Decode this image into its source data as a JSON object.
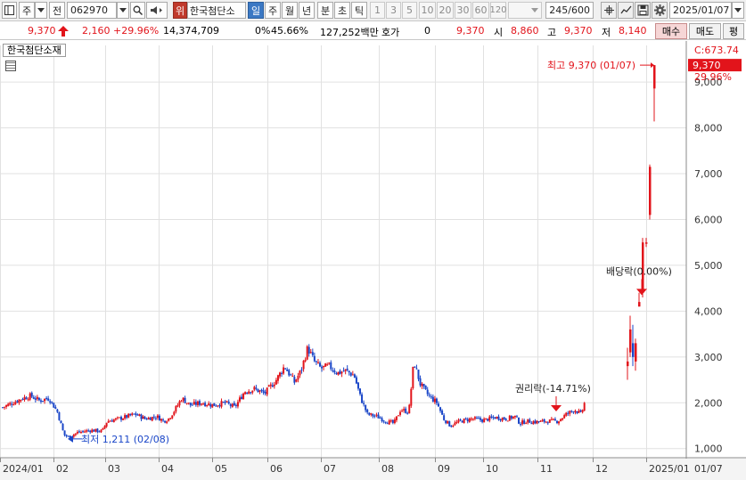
{
  "toolbar": {
    "mode_label": "주",
    "prev_label": "전",
    "code": "062970",
    "warning_badge": "위",
    "stock_name": "한국첨단소",
    "periods": [
      "일",
      "주",
      "월",
      "년",
      "분",
      "초",
      "틱"
    ],
    "active_period": "일",
    "intervals": [
      "1",
      "3",
      "5",
      "10",
      "20",
      "30",
      "60",
      "120"
    ],
    "count_display": "245/600",
    "date": "2025/01/07",
    "icons": [
      "layout-icon",
      "chevron-down-icon",
      "search-icon",
      "speaker-icon",
      "crosshair-icon",
      "chart-tool-icon",
      "save-icon",
      "gear-icon"
    ]
  },
  "quote": {
    "price": "9,370",
    "change": "2,160",
    "change_pct": "+29.96%",
    "volume": "14,374,709",
    "ratio_zero": "0%",
    "ratio": "45.66%",
    "amount": "127,252백만",
    "hoga_label": "호가",
    "hoga_value": "0",
    "hoga_price": "9,370",
    "open_label": "시",
    "open": "8,860",
    "high_label": "고",
    "high": "9,370",
    "low_label": "저",
    "low": "8,140",
    "buy_label": "매수",
    "sell_label": "매도",
    "avg_label": "평"
  },
  "chart": {
    "name_tag": "한국첨단소재",
    "price_flag": "9,370",
    "change_flag": "29.96%",
    "top_axis_label": "C:673.74",
    "annotations": {
      "high": "최고 9,370 (01/07)",
      "low": "최저 1,211 (02/08)",
      "dividend": "배당락(0.00%)",
      "rights": "권리락(-14.71%)"
    },
    "x_tick_labels": [
      "2024/01",
      "02",
      "03",
      "04",
      "05",
      "06",
      "07",
      "08",
      "09",
      "10",
      "11",
      "12",
      "2025/01",
      "01/07"
    ],
    "y_tick_labels": [
      "1,000",
      "2,000",
      "3,000",
      "4,000",
      "5,000",
      "6,000",
      "7,000",
      "8,000",
      "9,000"
    ],
    "up_color": "#e2141b",
    "down_color": "#1a46c8"
  },
  "chart_data": {
    "type": "candlestick",
    "title": "한국첨단소재",
    "ylim": [
      800,
      9800
    ],
    "y_ticks": [
      1000,
      2000,
      3000,
      4000,
      5000,
      6000,
      7000,
      8000,
      9000
    ],
    "months": [
      "2024/01",
      "02",
      "03",
      "04",
      "05",
      "06",
      "07",
      "08",
      "09",
      "10",
      "11",
      "12",
      "2025/01"
    ],
    "monthly_close": [
      1950,
      1300,
      1560,
      1730,
      1950,
      2250,
      2850,
      2050,
      2150,
      1620,
      1650,
      1800,
      9370
    ],
    "points": [
      {
        "d": 0,
        "c": 1900
      },
      {
        "d": 12,
        "c": 2000
      },
      {
        "d": 24,
        "c": 2100
      },
      {
        "d": 34,
        "c": 2150
      },
      {
        "d": 44,
        "c": 2050
      },
      {
        "d": 56,
        "c": 2100
      },
      {
        "d": 66,
        "c": 1800
      },
      {
        "d": 74,
        "c": 1300
      },
      {
        "d": 80,
        "c": 1250
      },
      {
        "d": 90,
        "c": 1350
      },
      {
        "d": 106,
        "c": 1400
      },
      {
        "d": 120,
        "c": 1380
      },
      {
        "d": 126,
        "c": 1600
      },
      {
        "d": 140,
        "c": 1650
      },
      {
        "d": 150,
        "c": 1700
      },
      {
        "d": 160,
        "c": 1750
      },
      {
        "d": 172,
        "c": 1650
      },
      {
        "d": 186,
        "c": 1700
      },
      {
        "d": 194,
        "c": 1600
      },
      {
        "d": 200,
        "c": 1650
      },
      {
        "d": 208,
        "c": 1850
      },
      {
        "d": 216,
        "c": 2100
      },
      {
        "d": 226,
        "c": 1950
      },
      {
        "d": 240,
        "c": 2000
      },
      {
        "d": 254,
        "c": 1950
      },
      {
        "d": 268,
        "c": 2000
      },
      {
        "d": 280,
        "c": 1900
      },
      {
        "d": 292,
        "c": 2250
      },
      {
        "d": 304,
        "c": 2300
      },
      {
        "d": 316,
        "c": 2200
      },
      {
        "d": 330,
        "c": 2500
      },
      {
        "d": 340,
        "c": 2800
      },
      {
        "d": 352,
        "c": 2450
      },
      {
        "d": 360,
        "c": 2700
      },
      {
        "d": 368,
        "c": 3200
      },
      {
        "d": 376,
        "c": 2900
      },
      {
        "d": 384,
        "c": 2750
      },
      {
        "d": 394,
        "c": 2800
      },
      {
        "d": 404,
        "c": 2650
      },
      {
        "d": 414,
        "c": 2700
      },
      {
        "d": 424,
        "c": 2600
      },
      {
        "d": 432,
        "c": 2100
      },
      {
        "d": 440,
        "c": 1750
      },
      {
        "d": 452,
        "c": 1700
      },
      {
        "d": 462,
        "c": 1600
      },
      {
        "d": 472,
        "c": 1550
      },
      {
        "d": 480,
        "c": 1850
      },
      {
        "d": 490,
        "c": 1800
      },
      {
        "d": 496,
        "c": 2900
      },
      {
        "d": 504,
        "c": 2400
      },
      {
        "d": 514,
        "c": 2150
      },
      {
        "d": 524,
        "c": 2000
      },
      {
        "d": 532,
        "c": 1650
      },
      {
        "d": 540,
        "c": 1500
      },
      {
        "d": 552,
        "c": 1600
      },
      {
        "d": 566,
        "c": 1650
      },
      {
        "d": 580,
        "c": 1620
      },
      {
        "d": 594,
        "c": 1680
      },
      {
        "d": 608,
        "c": 1650
      },
      {
        "d": 618,
        "c": 1700
      },
      {
        "d": 624,
        "c": 1550
      },
      {
        "d": 632,
        "c": 1600
      },
      {
        "d": 644,
        "c": 1580
      },
      {
        "d": 658,
        "c": 1600
      },
      {
        "d": 670,
        "c": 1600
      },
      {
        "d": 680,
        "c": 1750
      },
      {
        "d": 690,
        "c": 1850
      },
      {
        "d": 698,
        "c": 1750
      },
      {
        "d": 702,
        "c": 2000
      }
    ],
    "final_candles": [
      {
        "label": "12/18",
        "o": 2800,
        "h": 3200,
        "l": 2500,
        "c": 2900
      },
      {
        "label": "12/19",
        "o": 3100,
        "h": 3900,
        "l": 3000,
        "c": 3600
      },
      {
        "label": "12/20",
        "o": 3300,
        "h": 3700,
        "l": 2800,
        "c": 3000
      },
      {
        "label": "12/23",
        "o": 2900,
        "h": 3400,
        "l": 2700,
        "c": 3300
      },
      {
        "label": "12/27",
        "o": 4100,
        "h": 4400,
        "l": 4100,
        "c": 4200
      },
      {
        "label": "12/30",
        "o": 4400,
        "h": 5600,
        "l": 4300,
        "c": 5500
      },
      {
        "label": "01/02",
        "o": 5500,
        "h": 5600,
        "l": 5400,
        "c": 5500
      },
      {
        "label": "01/03",
        "o": 6100,
        "h": 7200,
        "l": 6000,
        "c": 7150
      },
      {
        "label": "01/07",
        "o": 8860,
        "h": 9370,
        "l": 8140,
        "c": 9370
      }
    ],
    "series": [
      {
        "name": "한국첨단소재",
        "type": "candlestick"
      }
    ]
  }
}
